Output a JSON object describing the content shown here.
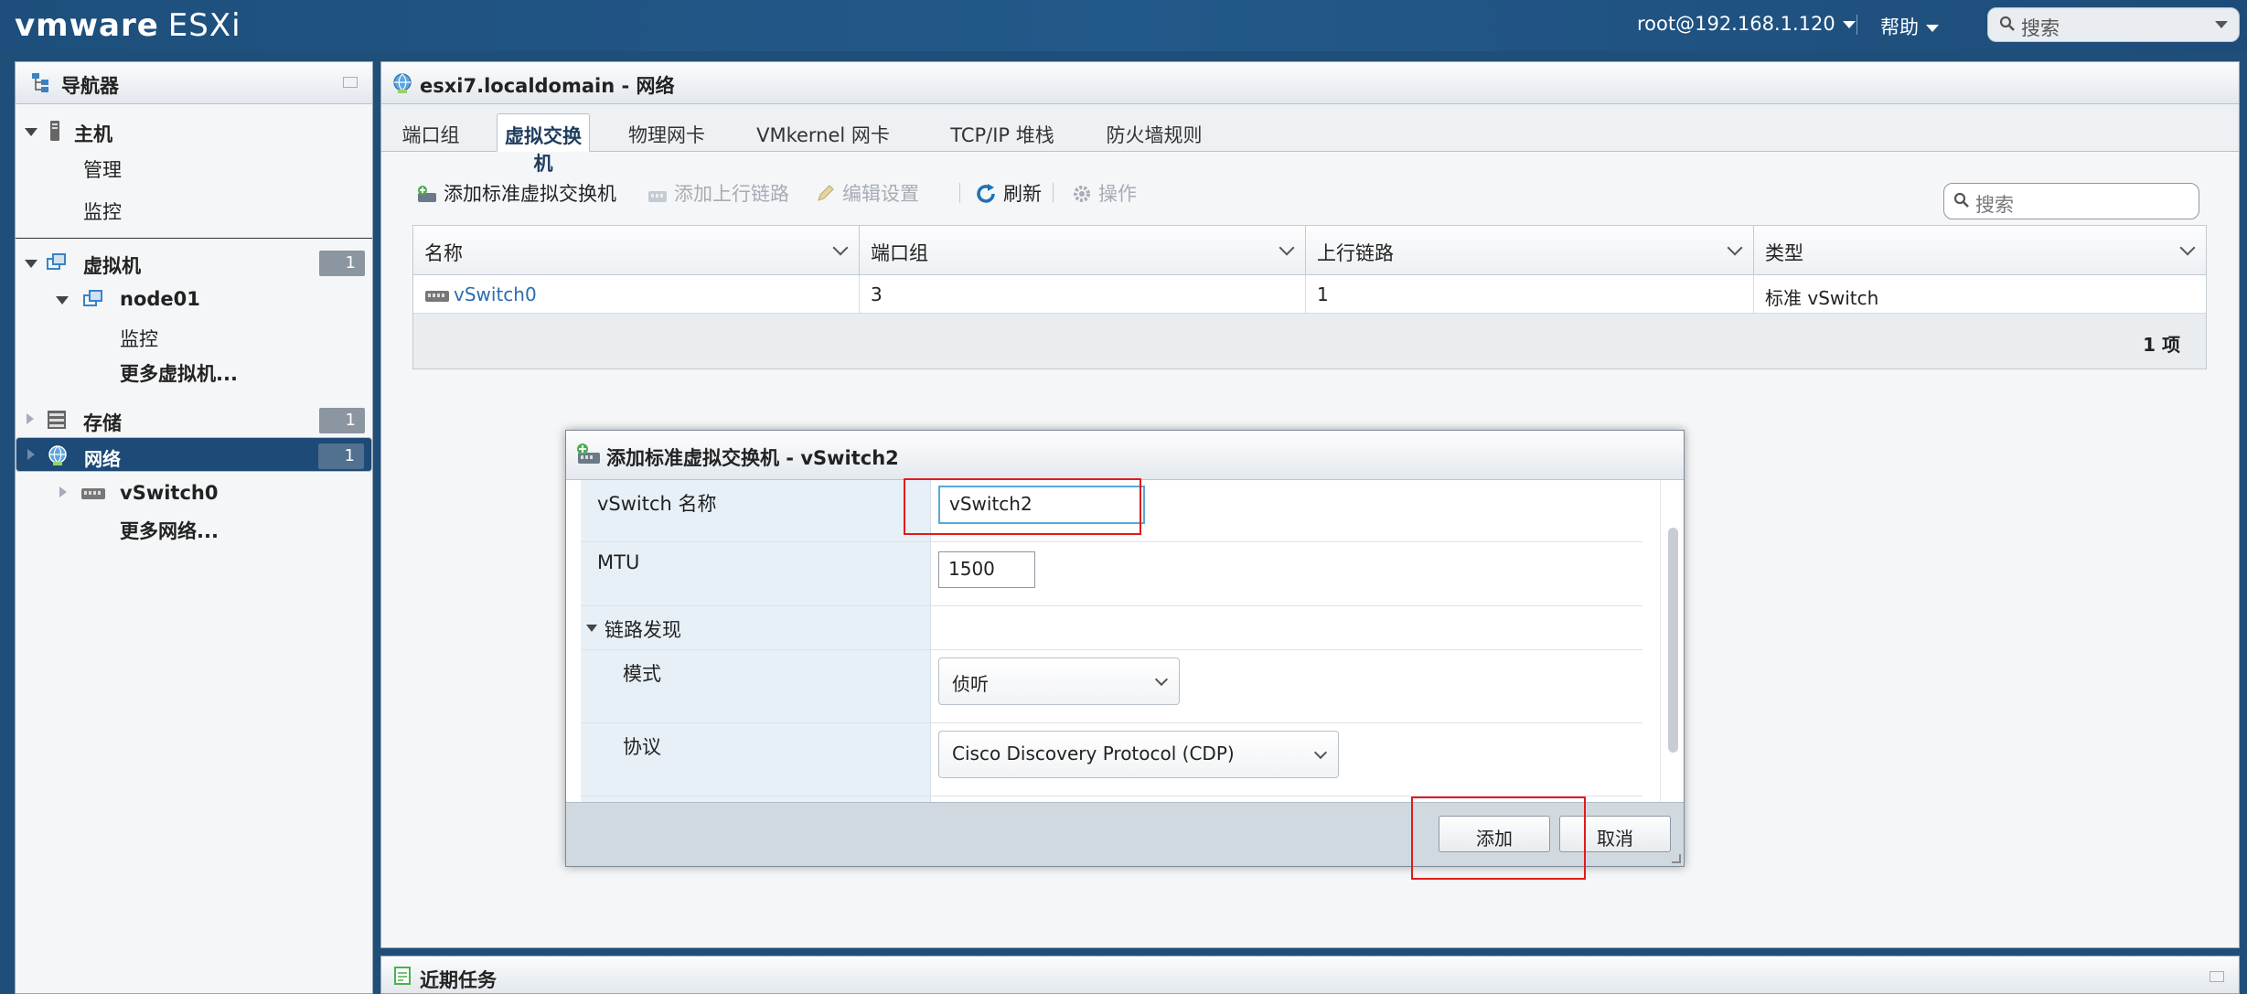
{
  "topbar": {
    "brand_vm": "vmware",
    "brand_esxi": "ESXi",
    "user": "root@192.168.1.120",
    "help": "帮助",
    "search_placeholder": "搜索"
  },
  "navigator": {
    "title": "导航器",
    "host": "主机",
    "host_manage": "管理",
    "host_monitor": "监控",
    "vms": "虚拟机",
    "vms_count": "1",
    "vm_node": "node01",
    "vm_monitor": "监控",
    "vm_more": "更多虚拟机...",
    "storage": "存储",
    "storage_count": "1",
    "network": "网络",
    "network_count": "1",
    "net_vswitch": "vSwitch0",
    "net_more": "更多网络..."
  },
  "main": {
    "title": "esxi7.localdomain - 网络",
    "tabs": [
      "端口组",
      "虚拟交换机",
      "物理网卡",
      "VMkernel 网卡",
      "TCP/IP 堆栈",
      "防火墙规则"
    ],
    "toolbar": {
      "add_vswitch": "添加标准虚拟交换机",
      "add_uplink": "添加上行链路",
      "edit": "编辑设置",
      "refresh": "刷新",
      "actions": "操作",
      "search_placeholder": "搜索"
    },
    "grid": {
      "columns": [
        "名称",
        "端口组",
        "上行链路",
        "类型"
      ],
      "rows": [
        {
          "name": "vSwitch0",
          "portgroups": "3",
          "uplinks": "1",
          "type": "标准 vSwitch"
        }
      ],
      "footer": "1 项"
    }
  },
  "tasks": {
    "title": "近期任务"
  },
  "dialog": {
    "title": "添加标准虚拟交换机 - vSwitch2",
    "fields": {
      "name_label": "vSwitch 名称",
      "name_value": "vSwitch2",
      "mtu_label": "MTU",
      "mtu_value": "1500",
      "link_discovery": "链路发现",
      "mode_label": "模式",
      "mode_value": "侦听",
      "protocol_label": "协议",
      "protocol_value": "Cisco Discovery Protocol (CDP)"
    },
    "add_button": "添加",
    "cancel_button": "取消"
  }
}
